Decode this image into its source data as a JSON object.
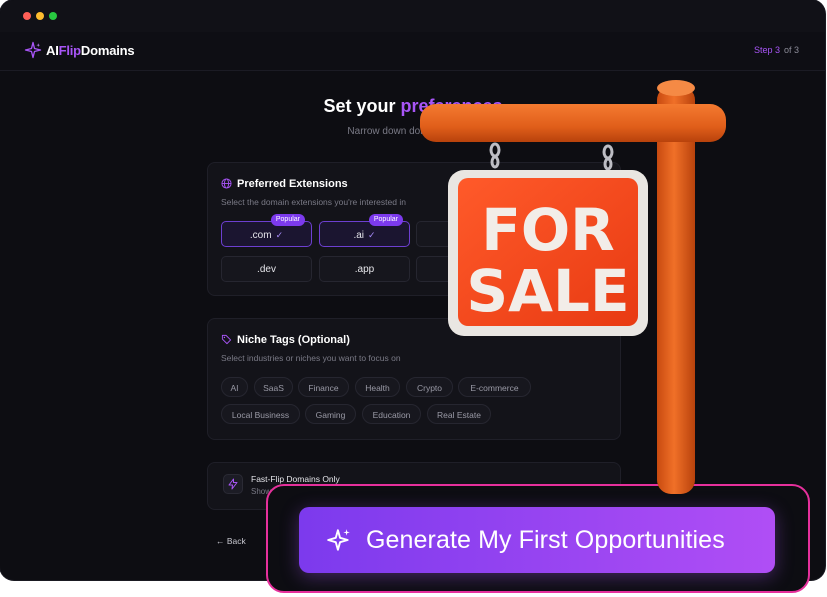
{
  "app": {
    "brand_prefix": "AI",
    "brand_highlight": "Flip",
    "brand_suffix": "Domains",
    "step_current": "Step 3",
    "step_total": "of 3"
  },
  "header": {
    "title_prefix": "Set your ",
    "title_highlight": "preferences",
    "subtitle": "Narrow down domain discove"
  },
  "extensions": {
    "title": "Preferred Extensions",
    "subtitle": "Select the domain extensions you're interested in",
    "items": [
      {
        "label": ".com",
        "selected": true,
        "badge": "Popular"
      },
      {
        "label": ".ai",
        "selected": true,
        "badge": "Popular"
      },
      {
        "label": ".dev",
        "selected": false,
        "badge": ""
      },
      {
        "label": ".app",
        "selected": false,
        "badge": ""
      }
    ],
    "check_glyph": "✓"
  },
  "niche": {
    "title": "Niche Tags (Optional)",
    "subtitle": "Select industries or niches you want to focus on",
    "tags": [
      "AI",
      "SaaS",
      "Finance",
      "Health",
      "Crypto",
      "E-commerce",
      "Local Business",
      "Gaming",
      "Education",
      "Real Estate"
    ]
  },
  "fast_flip": {
    "title": "Fast-Flip Domains Only",
    "subtitle": "Show"
  },
  "nav": {
    "back_label": "← Back"
  },
  "cta": {
    "label": "Generate My First Opportunities"
  },
  "sign": {
    "line1": "FOR",
    "line2": "SALE"
  },
  "colors": {
    "accent": "#a855f7",
    "frame": "#e6309c",
    "sign_face": "#f24a1d",
    "post": "#e8601c"
  }
}
